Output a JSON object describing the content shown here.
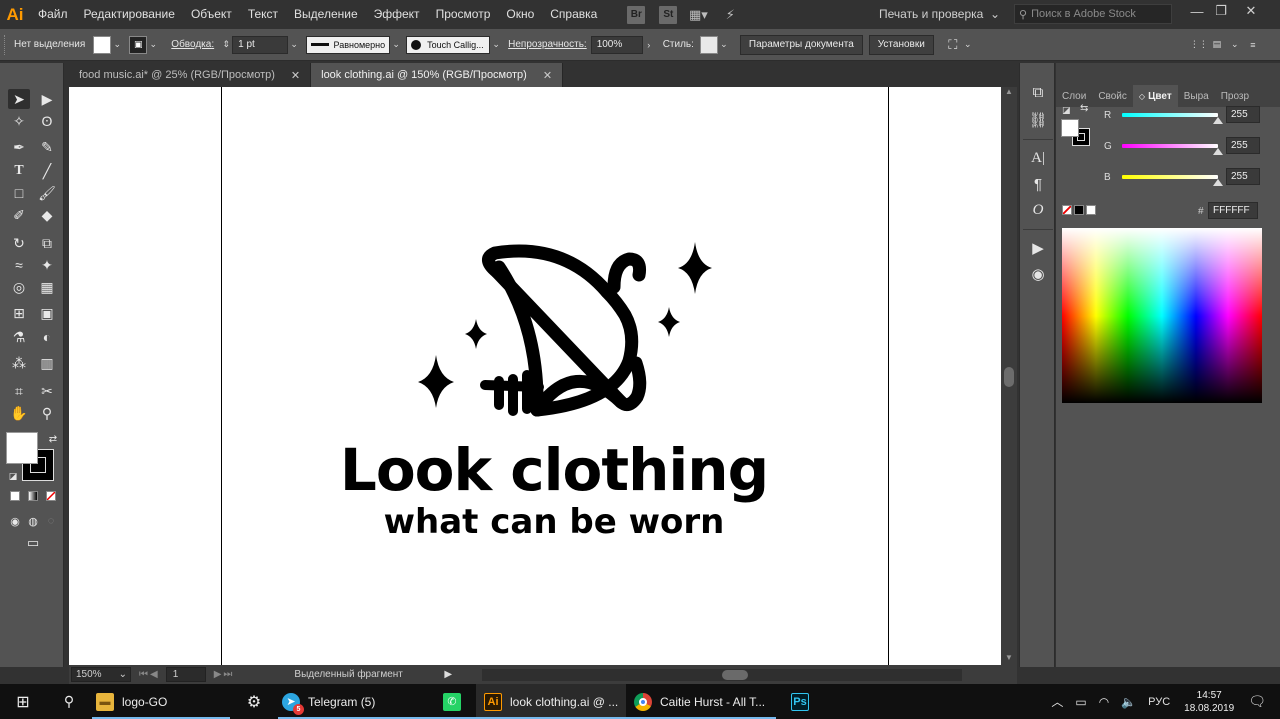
{
  "menubar": {
    "logo": "Ai",
    "items": [
      "Файл",
      "Редактирование",
      "Объект",
      "Текст",
      "Выделение",
      "Эффект",
      "Просмотр",
      "Окно",
      "Справка"
    ],
    "badges": [
      "Br",
      "St"
    ],
    "workspace": "Печать и проверка",
    "stock_search_placeholder": "Поиск в Adobe Stock"
  },
  "controlbar": {
    "selection_state": "Нет выделения",
    "stroke_label": "Обводка:",
    "stroke_weight": "1 pt",
    "stroke_profile": "Равномерно",
    "brush": "Touch Callig...",
    "opacity_label": "Непрозрачность:",
    "opacity_value": "100%",
    "style_label": "Стиль:",
    "doc_setup_button": "Параметры документа",
    "preferences_button": "Установки"
  },
  "doctabs": [
    {
      "label": "food music.ai* @ 25% (RGB/Просмотр)",
      "active": false
    },
    {
      "label": "look clothing.ai @ 150% (RGB/Просмотр)",
      "active": true
    }
  ],
  "artwork": {
    "title": "Look clothing",
    "tagline": "what can be worn",
    "colors": {
      "ink": "#000000",
      "artboard": "#ffffff"
    }
  },
  "statusbar": {
    "zoom": "150%",
    "page": "1",
    "status_text": "Выделенный фрагмент"
  },
  "colorpanel": {
    "tabs": [
      "Слои",
      "Свойс",
      "Цвет",
      "Выра",
      "Прозр"
    ],
    "active_tab": "Цвет",
    "r": {
      "label": "R",
      "value": "255",
      "color": "#00ffff"
    },
    "g": {
      "label": "G",
      "value": "255",
      "color": "#ff00ff"
    },
    "b": {
      "label": "B",
      "value": "255",
      "color": "#ffff00"
    },
    "hex_label": "#",
    "hex": "FFFFFF"
  },
  "taskbar": {
    "items": [
      {
        "label": "logo-GO",
        "icon": "folder-icon"
      },
      {
        "label": "",
        "icon": "gear-icon"
      },
      {
        "label": "Telegram (5)",
        "icon": "telegram-icon"
      },
      {
        "label": "",
        "icon": "whatsapp-icon"
      },
      {
        "label": "look clothing.ai @ ...",
        "icon": "illustrator-icon"
      },
      {
        "label": "Caitie Hurst - All T...",
        "icon": "chrome-icon"
      },
      {
        "label": "",
        "icon": "photoshop-icon"
      }
    ],
    "telegram_badge": "5",
    "ai_icon": "Ai",
    "ps_icon": "Ps",
    "lang": "РУС",
    "time": "14:57",
    "date": "18.08.2019"
  }
}
